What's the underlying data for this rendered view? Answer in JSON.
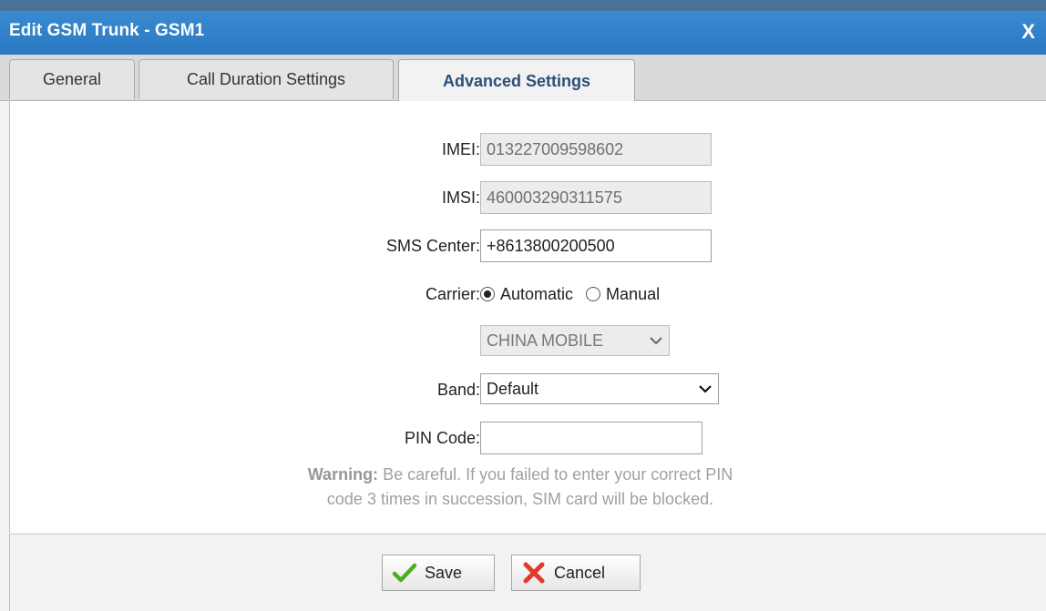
{
  "dialog": {
    "title": "Edit GSM Trunk - GSM1",
    "close_label": "X"
  },
  "tabs": [
    {
      "label": "General",
      "active": false
    },
    {
      "label": "Call Duration Settings",
      "active": false
    },
    {
      "label": "Advanced Settings",
      "active": true
    }
  ],
  "form": {
    "imei": {
      "label": "IMEI:",
      "value": "013227009598602"
    },
    "imsi": {
      "label": "IMSI:",
      "value": "460003290311575"
    },
    "sms_center": {
      "label": "SMS Center:",
      "value": "+8613800200500"
    },
    "carrier": {
      "label": "Carrier:",
      "options": [
        {
          "label": "Automatic",
          "checked": true
        },
        {
          "label": "Manual",
          "checked": false
        }
      ],
      "operator_value": "CHINA MOBILE"
    },
    "band": {
      "label": "Band:",
      "value": "Default"
    },
    "pin_code": {
      "label": "PIN Code:",
      "value": ""
    },
    "warning": {
      "bold": "Warning:",
      "line1": " Be careful. If you failed to enter your correct PIN",
      "line2": "code 3 times in succession, SIM card will be blocked."
    }
  },
  "buttons": {
    "save_label": "Save",
    "cancel_label": "Cancel"
  },
  "colors": {
    "header": "#2f7fc8",
    "active_tab_text": "#2c4f78",
    "save_check": "#4caf1f",
    "cancel_x": "#e03a2a"
  },
  "icons": {
    "save": "check-icon",
    "cancel": "cross-icon",
    "dropdown": "chevron-down-icon"
  }
}
